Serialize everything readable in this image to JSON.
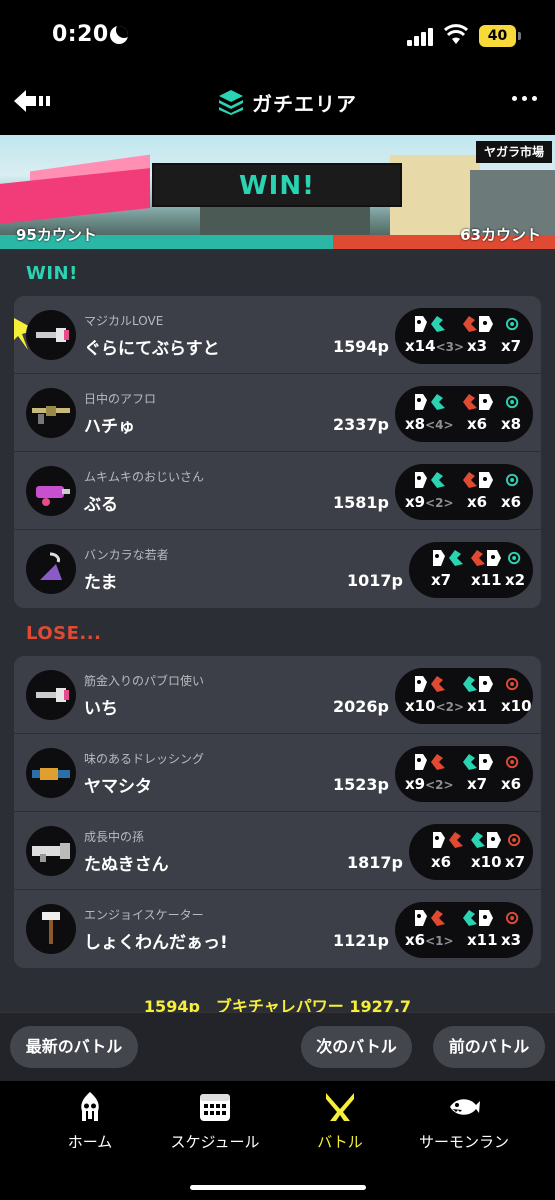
{
  "status_bar": {
    "time": "0:20",
    "battery": "40"
  },
  "header": {
    "title": "ガチエリア"
  },
  "banner": {
    "result": "WIN!",
    "stage": "ヤガラ市場",
    "my_count": "95カウント",
    "enemy_count": "63カウント",
    "colors": {
      "win": "#2ad4b2",
      "lose": "#e04a33"
    }
  },
  "win_team": {
    "label": "WIN!",
    "players": [
      {
        "byname": "マジカルLOVE",
        "name": "ぐらにてぶらすと",
        "points": "1594p",
        "kills": "x14",
        "assists": "<3>",
        "deaths": "x3",
        "special": "x7",
        "weapon_icon": "brush-weapon-icon",
        "special_icon": "special-icon"
      },
      {
        "byname": "日中のアフロ",
        "name": "ハチゅ",
        "points": "2337p",
        "kills": "x8",
        "assists": "<4>",
        "deaths": "x6",
        "special": "x8",
        "weapon_icon": "charger-weapon-icon",
        "special_icon": "special-icon"
      },
      {
        "byname": "ムキムキのおじいさん",
        "name": "ぶる",
        "points": "1581p",
        "kills": "x9",
        "assists": "<2>",
        "deaths": "x6",
        "special": "x6",
        "weapon_icon": "shooter-weapon-icon",
        "special_icon": "special-icon"
      },
      {
        "byname": "バンカラな若者",
        "name": "たま",
        "points": "1017p",
        "kills": "x7",
        "assists": "",
        "deaths": "x11",
        "special": "x2",
        "weapon_icon": "brella-weapon-icon",
        "special_icon": "special-icon"
      }
    ]
  },
  "lose_team": {
    "label": "LOSE...",
    "players": [
      {
        "byname": "筋金入りのパブロ使い",
        "name": "いち",
        "points": "2026p",
        "kills": "x10",
        "assists": "<2>",
        "deaths": "x1",
        "special": "x10",
        "weapon_icon": "brush-weapon-icon",
        "special_icon": "special-icon"
      },
      {
        "byname": "味のあるドレッシング",
        "name": "ヤマシタ",
        "points": "1523p",
        "kills": "x9",
        "assists": "<2>",
        "deaths": "x7",
        "special": "x6",
        "weapon_icon": "splatling-weapon-icon",
        "special_icon": "special-icon"
      },
      {
        "byname": "成長中の孫",
        "name": "たぬきさん",
        "points": "1817p",
        "kills": "x6",
        "assists": "",
        "deaths": "x10",
        "special": "x7",
        "weapon_icon": "blaster-weapon-icon",
        "special_icon": "special-icon"
      },
      {
        "byname": "エンジョイスケーター",
        "name": "しょくわんだぁっ!",
        "points": "1121p",
        "kills": "x6",
        "assists": "<1>",
        "deaths": "x11",
        "special": "x3",
        "weapon_icon": "roller-weapon-icon",
        "special_icon": "special-icon"
      }
    ]
  },
  "summary": "1594p　ブキチャレパワー 1927.7",
  "nav_buttons": {
    "latest": "最新のバトル",
    "next": "次のバトル",
    "prev": "前のバトル"
  },
  "tabs": [
    {
      "label": "ホーム",
      "icon": "squid-icon",
      "active": false
    },
    {
      "label": "スケジュール",
      "icon": "calendar-icon",
      "active": false
    },
    {
      "label": "バトル",
      "icon": "battle-icon",
      "active": true
    },
    {
      "label": "サーモンラン",
      "icon": "salmon-icon",
      "active": false
    }
  ]
}
